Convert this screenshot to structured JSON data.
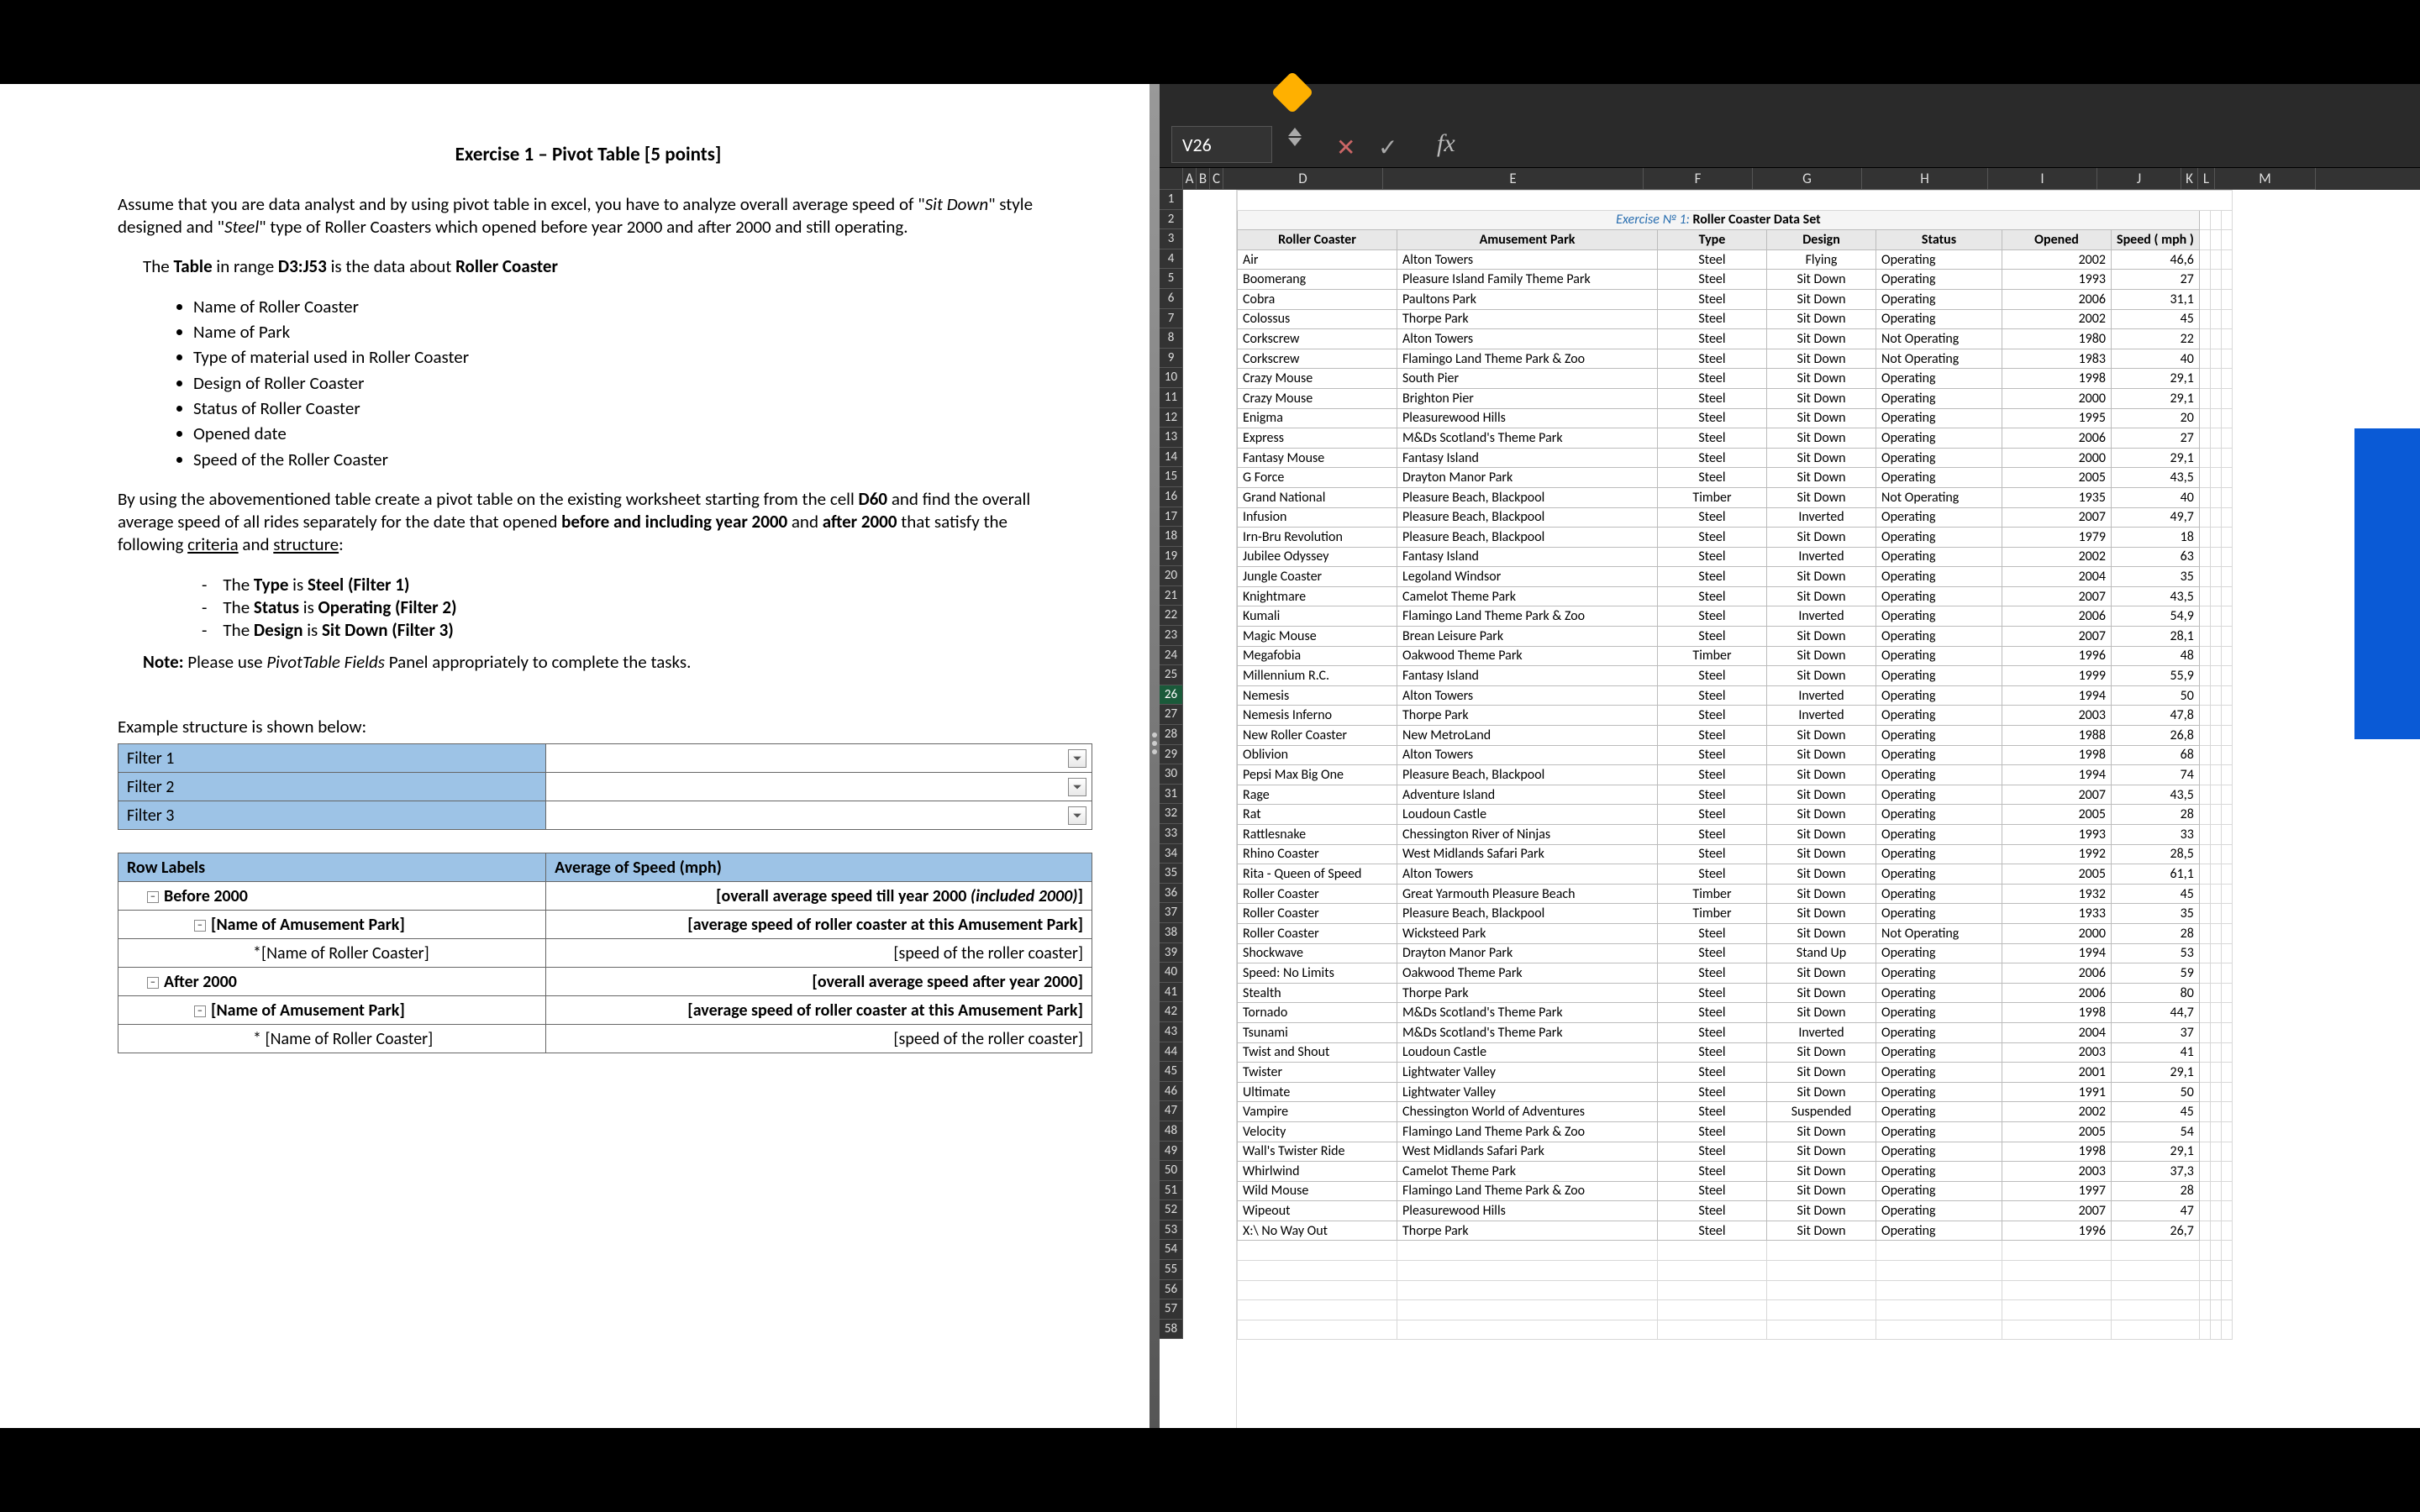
{
  "doc": {
    "title": "Exercise 1 – Pivot Table [5 points]",
    "p1_a": "Assume that you are data analyst and by using pivot table in excel, you have to analyze overall average speed of \"",
    "p1_sit": "Sit Down",
    "p1_b": "\" style designed and \"",
    "p1_steel": "Steel",
    "p1_c": "\" type of Roller Coasters which opened before year 2000 and after 2000 and still operating.",
    "p2_a": "The ",
    "p2_table": "Table",
    "p2_b": " in range ",
    "p2_range": "D3:J53",
    "p2_c": " is the data about ",
    "p2_rc": "Roller Coaster",
    "bullets": [
      "Name of Roller Coaster",
      "Name of Park",
      "Type of material used in Roller Coaster",
      "Design of Roller Coaster",
      "Status of Roller Coaster",
      "Opened date",
      "Speed of the Roller Coaster"
    ],
    "p3_a": "By using the abovementioned table create a pivot table on the existing worksheet starting from the cell ",
    "p3_cell": "D60",
    "p3_b": " and find the overall average speed of all rides separately for the date that opened ",
    "p3_before": "before and including year 2000",
    "p3_c": " and ",
    "p3_after": "after 2000",
    "p3_d": " that satisfy the following ",
    "p3_crit": "criteria",
    "p3_e": " and ",
    "p3_struct": "structure",
    "p3_f": ":",
    "d1_a": "The ",
    "d1_k": "Type",
    "d1_b": " is ",
    "d1_v": "Steel (Filter 1)",
    "d2_a": "The ",
    "d2_k": "Status",
    "d2_b": " is ",
    "d2_v": "Operating (Filter 2)",
    "d3_a": "The ",
    "d3_k": "Design",
    "d3_b": " is ",
    "d3_v": "Sit Down (Filter 3)",
    "note_k": "Note:",
    "note_a": " Please use ",
    "note_i": "PivotTable Fields",
    "note_b": " Panel appropriately to complete the tasks.",
    "example": "Example structure is shown below:",
    "f1": "Filter 1",
    "f2": "Filter 2",
    "f3": "Filter 3",
    "rowlabels": "Row Labels",
    "avg": "Average of Speed (mph)",
    "b2000": "Before 2000",
    "ovb_a": "[overall average speed till year 2000 ",
    "ovb_b": "(included 2000)",
    "ovb_c": "]",
    "napA": "[Name of Amusement Park]",
    "avgpark": "[average speed of roller coaster at this Amusement Park]",
    "nrcA": "*[Name of Roller Coaster]",
    "sprc": "[speed of the roller coaster]",
    "a2000": "After 2000",
    "ova": "[overall average speed  after year 2000]",
    "napB": "[Name of Amusement Park]",
    "avgparkB": "[average speed of  roller coaster at  this Amusement Park]",
    "nrcB": "* [Name of Roller Coaster]"
  },
  "ss": {
    "namebox": "V26",
    "fx": "fx",
    "title_a": "Exercise № 1:",
    "title_b": " Roller Coaster Data Set",
    "headers": {
      "d": "Roller Coaster",
      "e": "Amusement Park",
      "f": "Type",
      "g": "Design",
      "h": "Status",
      "i": "Opened",
      "j": "Speed ( mph )"
    },
    "cols": [
      "A",
      "B",
      "C",
      "D",
      "E",
      "F",
      "G",
      "H",
      "I",
      "J",
      "K",
      "L",
      "M"
    ],
    "colw": {
      "A": 16,
      "B": 16,
      "C": 16,
      "D": 190,
      "E": 310,
      "F": 130,
      "G": 130,
      "H": 150,
      "I": 130,
      "J": 100,
      "K": 20,
      "L": 20,
      "M": 120
    },
    "rows_start": 1,
    "rows_end": 58,
    "sel_row": 26,
    "data": [
      [
        "Air",
        "Alton Towers",
        "Steel",
        "Flying",
        "Operating",
        "2002",
        "46,6"
      ],
      [
        "Boomerang",
        "Pleasure Island Family Theme Park",
        "Steel",
        "Sit Down",
        "Operating",
        "1993",
        "27"
      ],
      [
        "Cobra",
        "Paultons Park",
        "Steel",
        "Sit Down",
        "Operating",
        "2006",
        "31,1"
      ],
      [
        "Colossus",
        "Thorpe Park",
        "Steel",
        "Sit Down",
        "Operating",
        "2002",
        "45"
      ],
      [
        "Corkscrew",
        "Alton Towers",
        "Steel",
        "Sit Down",
        "Not Operating",
        "1980",
        "22"
      ],
      [
        "Corkscrew",
        "Flamingo Land Theme Park & Zoo",
        "Steel",
        "Sit Down",
        "Not Operating",
        "1983",
        "40"
      ],
      [
        "Crazy Mouse",
        "South Pier",
        "Steel",
        "Sit Down",
        "Operating",
        "1998",
        "29,1"
      ],
      [
        "Crazy Mouse",
        "Brighton Pier",
        "Steel",
        "Sit Down",
        "Operating",
        "2000",
        "29,1"
      ],
      [
        "Enigma",
        "Pleasurewood Hills",
        "Steel",
        "Sit Down",
        "Operating",
        "1995",
        "20"
      ],
      [
        "Express",
        "M&Ds Scotland's Theme Park",
        "Steel",
        "Sit Down",
        "Operating",
        "2006",
        "27"
      ],
      [
        "Fantasy Mouse",
        "Fantasy Island",
        "Steel",
        "Sit Down",
        "Operating",
        "2000",
        "29,1"
      ],
      [
        "G Force",
        "Drayton Manor Park",
        "Steel",
        "Sit Down",
        "Operating",
        "2005",
        "43,5"
      ],
      [
        "Grand National",
        "Pleasure Beach, Blackpool",
        "Timber",
        "Sit Down",
        "Not Operating",
        "1935",
        "40"
      ],
      [
        "Infusion",
        "Pleasure Beach, Blackpool",
        "Steel",
        "Inverted",
        "Operating",
        "2007",
        "49,7"
      ],
      [
        "Irn-Bru Revolution",
        "Pleasure Beach, Blackpool",
        "Steel",
        "Sit Down",
        "Operating",
        "1979",
        "18"
      ],
      [
        "Jubilee Odyssey",
        "Fantasy Island",
        "Steel",
        "Inverted",
        "Operating",
        "2002",
        "63"
      ],
      [
        "Jungle Coaster",
        "Legoland Windsor",
        "Steel",
        "Sit Down",
        "Operating",
        "2004",
        "35"
      ],
      [
        "Knightmare",
        "Camelot Theme Park",
        "Steel",
        "Sit Down",
        "Operating",
        "2007",
        "43,5"
      ],
      [
        "Kumali",
        "Flamingo Land Theme Park & Zoo",
        "Steel",
        "Inverted",
        "Operating",
        "2006",
        "54,9"
      ],
      [
        "Magic Mouse",
        "Brean Leisure Park",
        "Steel",
        "Sit Down",
        "Operating",
        "2007",
        "28,1"
      ],
      [
        "Megafobia",
        "Oakwood Theme Park",
        "Timber",
        "Sit Down",
        "Operating",
        "1996",
        "48"
      ],
      [
        "Millennium R.C.",
        "Fantasy Island",
        "Steel",
        "Sit Down",
        "Operating",
        "1999",
        "55,9"
      ],
      [
        "Nemesis",
        "Alton Towers",
        "Steel",
        "Inverted",
        "Operating",
        "1994",
        "50"
      ],
      [
        "Nemesis Inferno",
        "Thorpe Park",
        "Steel",
        "Inverted",
        "Operating",
        "2003",
        "47,8"
      ],
      [
        "New Roller Coaster",
        "New MetroLand",
        "Steel",
        "Sit Down",
        "Operating",
        "1988",
        "26,8"
      ],
      [
        "Oblivion",
        "Alton Towers",
        "Steel",
        "Sit Down",
        "Operating",
        "1998",
        "68"
      ],
      [
        "Pepsi Max Big One",
        "Pleasure Beach, Blackpool",
        "Steel",
        "Sit Down",
        "Operating",
        "1994",
        "74"
      ],
      [
        "Rage",
        "Adventure Island",
        "Steel",
        "Sit Down",
        "Operating",
        "2007",
        "43,5"
      ],
      [
        "Rat",
        "Loudoun Castle",
        "Steel",
        "Sit Down",
        "Operating",
        "2005",
        "28"
      ],
      [
        "Rattlesnake",
        "Chessington River of Ninjas",
        "Steel",
        "Sit Down",
        "Operating",
        "1993",
        "33"
      ],
      [
        "Rhino Coaster",
        "West Midlands Safari Park",
        "Steel",
        "Sit Down",
        "Operating",
        "1992",
        "28,5"
      ],
      [
        "Rita - Queen of Speed",
        "Alton Towers",
        "Steel",
        "Sit Down",
        "Operating",
        "2005",
        "61,1"
      ],
      [
        "Roller Coaster",
        "Great Yarmouth Pleasure Beach",
        "Timber",
        "Sit Down",
        "Operating",
        "1932",
        "45"
      ],
      [
        "Roller Coaster",
        "Pleasure Beach, Blackpool",
        "Timber",
        "Sit Down",
        "Operating",
        "1933",
        "35"
      ],
      [
        "Roller Coaster",
        "Wicksteed Park",
        "Steel",
        "Sit Down",
        "Not Operating",
        "2000",
        "28"
      ],
      [
        "Shockwave",
        "Drayton Manor Park",
        "Steel",
        "Stand Up",
        "Operating",
        "1994",
        "53"
      ],
      [
        "Speed: No Limits",
        "Oakwood Theme Park",
        "Steel",
        "Sit Down",
        "Operating",
        "2006",
        "59"
      ],
      [
        "Stealth",
        "Thorpe Park",
        "Steel",
        "Sit Down",
        "Operating",
        "2006",
        "80"
      ],
      [
        "Tornado",
        "M&Ds Scotland's Theme Park",
        "Steel",
        "Sit Down",
        "Operating",
        "1998",
        "44,7"
      ],
      [
        "Tsunami",
        "M&Ds Scotland's Theme Park",
        "Steel",
        "Inverted",
        "Operating",
        "2004",
        "37"
      ],
      [
        "Twist and Shout",
        "Loudoun Castle",
        "Steel",
        "Sit Down",
        "Operating",
        "2003",
        "41"
      ],
      [
        "Twister",
        "Lightwater Valley",
        "Steel",
        "Sit Down",
        "Operating",
        "2001",
        "29,1"
      ],
      [
        "Ultimate",
        "Lightwater Valley",
        "Steel",
        "Sit Down",
        "Operating",
        "1991",
        "50"
      ],
      [
        "Vampire",
        "Chessington World of Adventures",
        "Steel",
        "Suspended",
        "Operating",
        "2002",
        "45"
      ],
      [
        "Velocity",
        "Flamingo Land Theme Park & Zoo",
        "Steel",
        "Sit Down",
        "Operating",
        "2005",
        "54"
      ],
      [
        "Wall's Twister Ride",
        "West Midlands Safari Park",
        "Steel",
        "Sit Down",
        "Operating",
        "1998",
        "29,1"
      ],
      [
        "Whirlwind",
        "Camelot Theme Park",
        "Steel",
        "Sit Down",
        "Operating",
        "2003",
        "37,3"
      ],
      [
        "Wild Mouse",
        "Flamingo Land Theme Park & Zoo",
        "Steel",
        "Sit Down",
        "Operating",
        "1997",
        "28"
      ],
      [
        "Wipeout",
        "Pleasurewood Hills",
        "Steel",
        "Sit Down",
        "Operating",
        "2007",
        "47"
      ],
      [
        "X:\\ No Way Out",
        "Thorpe Park",
        "Steel",
        "Sit Down",
        "Operating",
        "1996",
        "26,7"
      ]
    ]
  }
}
